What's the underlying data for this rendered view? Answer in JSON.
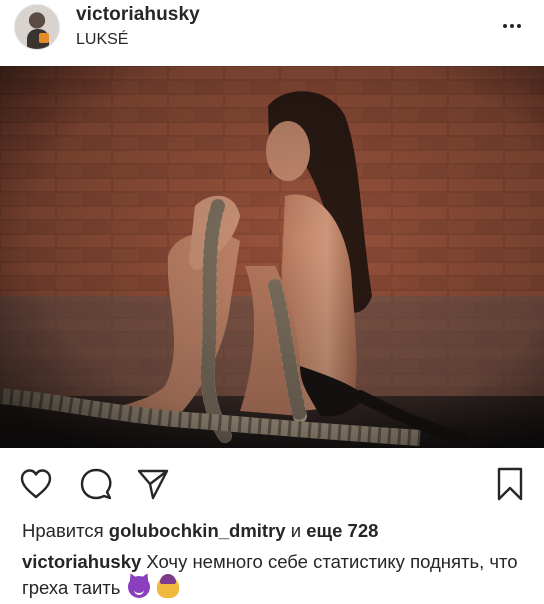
{
  "post": {
    "username": "victoriahusky",
    "location": "LUKSÉ",
    "more_icon": "more-horizontal-icon"
  },
  "photo": {
    "alt": "",
    "colors": {
      "brick": "#8a4a36",
      "mortar": "#5e3528",
      "floor": "#2a2626",
      "rope": "#b8ab98",
      "skin": "#c98f73",
      "hair": "#2b1a14"
    }
  },
  "actions": {
    "like_icon": "heart-outline-icon",
    "comment_icon": "comment-bubble-icon",
    "share_icon": "paper-plane-icon",
    "save_icon": "bookmark-outline-icon"
  },
  "likes": {
    "prefix": "Нравится",
    "user": "golubochkin_dmitry",
    "middle": "и",
    "more": "еще 728"
  },
  "caption": {
    "user": "victoriahusky",
    "text": "Хочу немного себе статистику поднять, что греха таить",
    "emoji_1": "smiling-devil-emoji",
    "emoji_2": "person-shrugging-emoji"
  }
}
